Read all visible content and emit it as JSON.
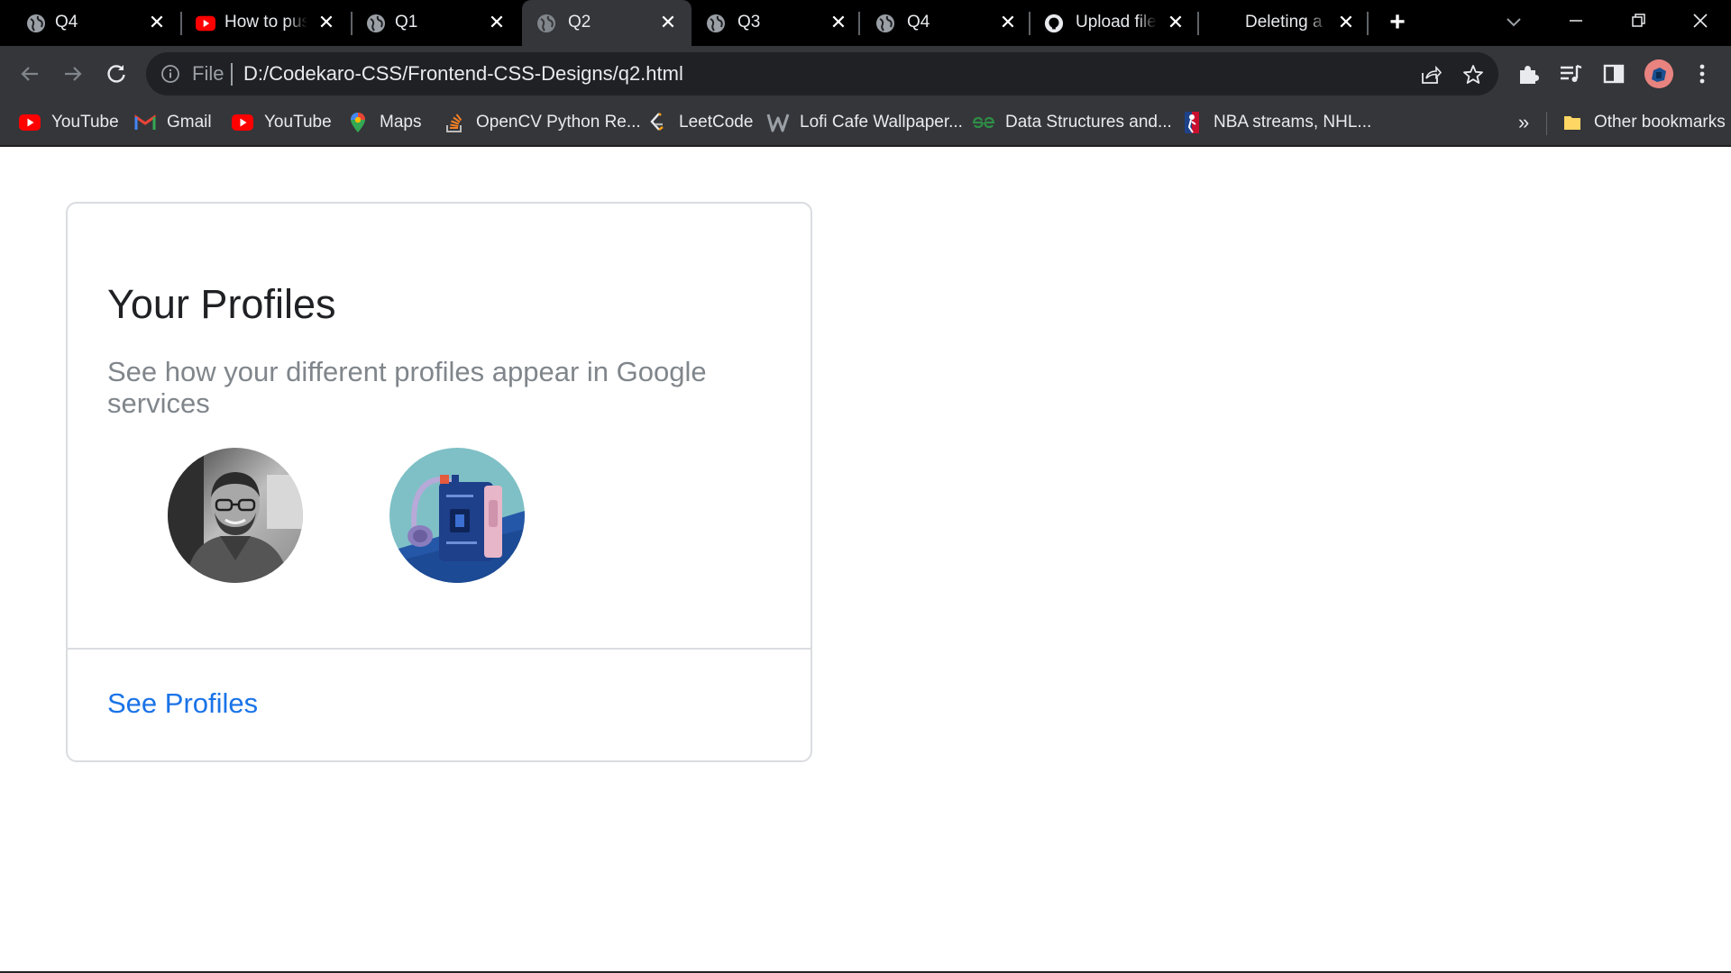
{
  "browser": {
    "tabs": [
      {
        "title": "Q4",
        "icon": "globe-icon"
      },
      {
        "title": "How to push",
        "icon": "youtube-icon"
      },
      {
        "title": "Q1",
        "icon": "globe-icon"
      },
      {
        "title": "Q2",
        "icon": "globe-icon",
        "active": true
      },
      {
        "title": "Q3",
        "icon": "globe-icon"
      },
      {
        "title": "Q4",
        "icon": "globe-icon"
      },
      {
        "title": "Upload files",
        "icon": "github-icon"
      },
      {
        "title": "Deleting a repository",
        "icon": "none"
      }
    ],
    "new_tab_icon": "plus-icon",
    "address_bar": {
      "scheme_label": "File",
      "url": "D:/Codekaro-CSS/Frontend-CSS-Designs/q2.html"
    },
    "bookmarks": [
      {
        "label": "YouTube",
        "icon": "youtube-icon"
      },
      {
        "label": "Gmail",
        "icon": "gmail-icon"
      },
      {
        "label": "YouTube",
        "icon": "youtube-icon"
      },
      {
        "label": "Maps",
        "icon": "maps-icon"
      },
      {
        "label": "OpenCV Python Re...",
        "icon": "stackoverflow-icon"
      },
      {
        "label": "LeetCode",
        "icon": "leetcode-icon"
      },
      {
        "label": "Lofi Cafe Wallpaper...",
        "icon": "wallpaper-icon"
      },
      {
        "label": "Data Structures and...",
        "icon": "gfg-icon"
      },
      {
        "label": "NBA streams, NHL...",
        "icon": "nba-icon"
      }
    ],
    "bookmarks_overflow": "»",
    "other_bookmarks": "Other bookmarks"
  },
  "card": {
    "title": "Your Profiles",
    "subtitle": "See how your different profiles appear in Google services",
    "profiles": [
      {
        "name": "profile-photo-person"
      },
      {
        "name": "profile-photo-cassette-player"
      }
    ],
    "link_label": "See Profiles"
  },
  "colors": {
    "tabstrip": "#000000",
    "toolbar": "#35363a",
    "omnibox": "#202124",
    "link": "#1a73e8",
    "subtitle": "#80868b",
    "card_border": "#dadce0"
  }
}
